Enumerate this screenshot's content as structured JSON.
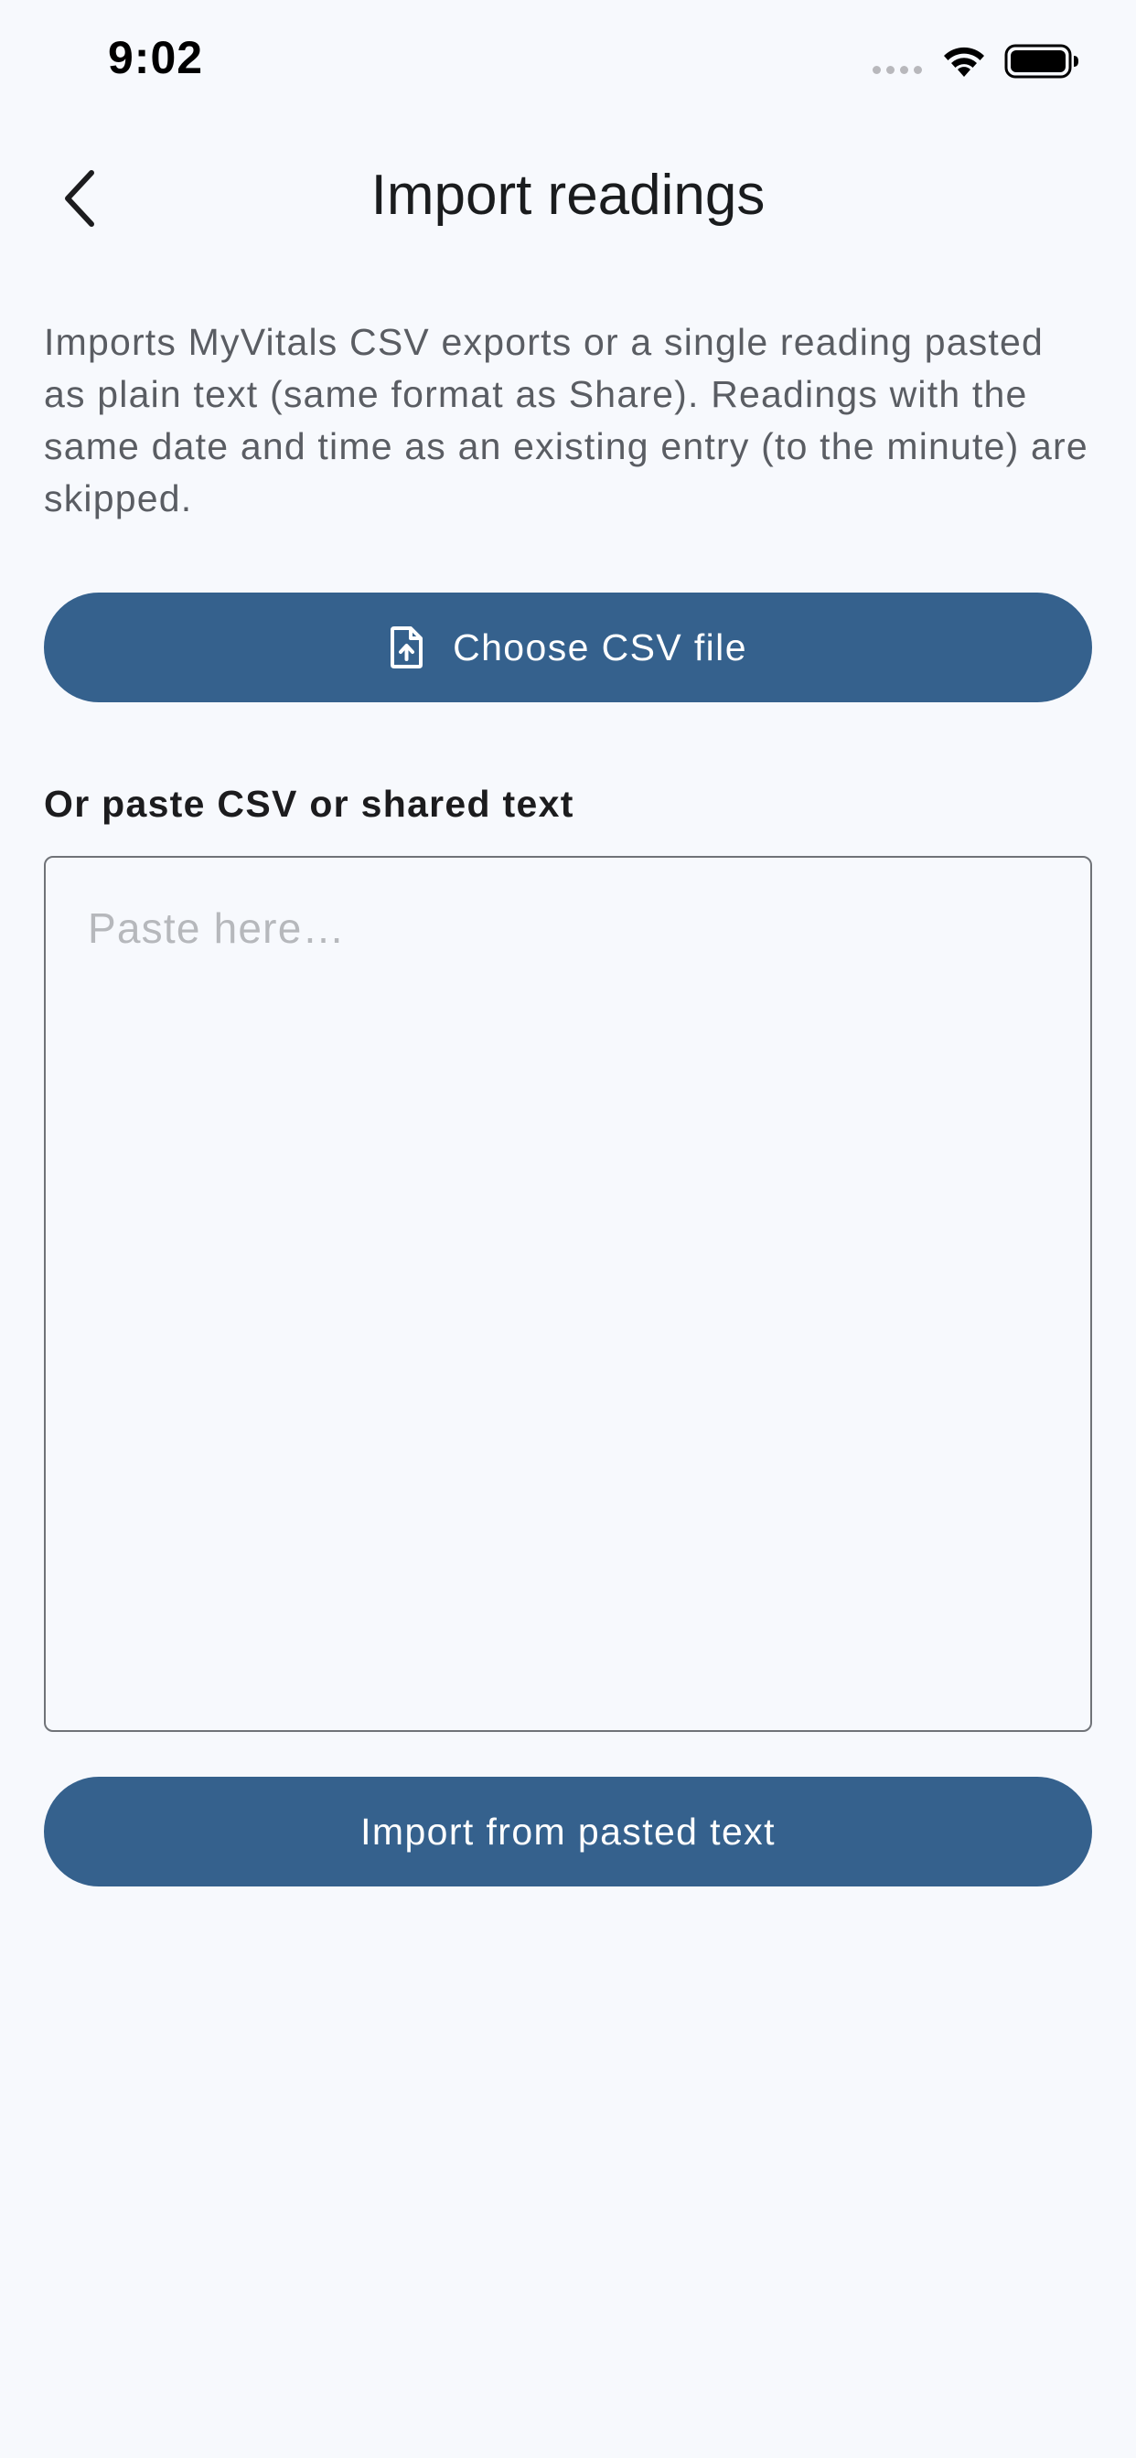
{
  "status_bar": {
    "time": "9:02"
  },
  "header": {
    "title": "Import readings",
    "back_icon": "chevron-left-icon"
  },
  "description": "Imports MyVitals CSV exports or a single reading pasted as plain text (same format as Share). Readings with the same date and time as an existing entry (to the minute) are skipped.",
  "choose_file": {
    "label": "Choose CSV file",
    "icon": "file-upload-icon"
  },
  "paste": {
    "label": "Or paste CSV or shared text",
    "value": "",
    "placeholder": "Paste here…"
  },
  "import_button": {
    "label": "Import from pasted text"
  },
  "colors": {
    "background": "#f7f9fd",
    "primary": "#35618d",
    "text": "#1c1c1e",
    "secondary_text": "#5a5d63",
    "placeholder": "#b6b8bc",
    "border": "#707378"
  }
}
